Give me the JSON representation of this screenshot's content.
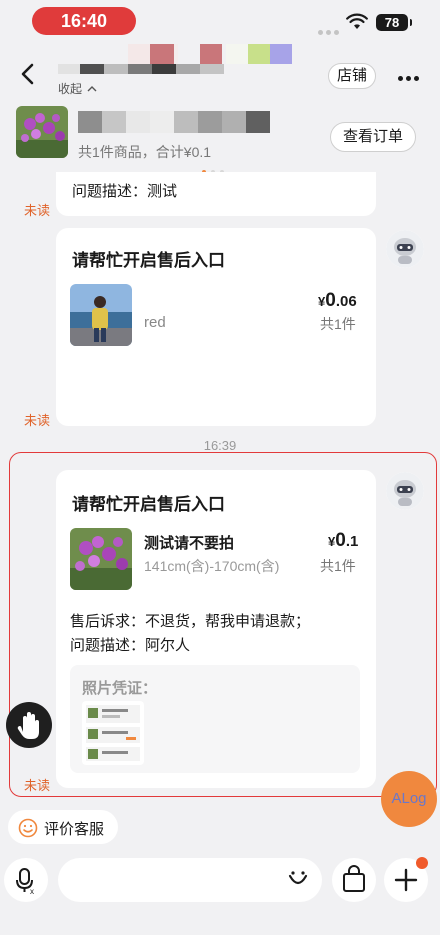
{
  "status_bar": {
    "time": "16:40",
    "battery": "78"
  },
  "header": {
    "collapse_label": "收起",
    "shop_label": "店铺"
  },
  "order_banner": {
    "summary": "共1件商品，合计¥0.1",
    "view_order_label": "查看订单"
  },
  "messages": [
    {
      "issue_text": "问题描述：测试",
      "unread": "未读"
    },
    {
      "title": "请帮忙开启售后入口",
      "product_name": "red",
      "price_symbol": "¥",
      "price_int": "0",
      "price_dec": ".06",
      "qty": "共1件",
      "unread": "未读"
    },
    {
      "title": "请帮忙开启售后入口",
      "product_name": "测试请不要拍",
      "product_spec": "141cm(含)-170cm(含)",
      "price_symbol": "¥",
      "price_int": "0",
      "price_dec": ".1",
      "qty": "共1件",
      "request_text": "售后诉求：不退货，帮我申请退款；",
      "issue_text": "问题描述：阿尔人",
      "photo_label": "照片凭证：",
      "unread": "未读"
    }
  ],
  "timestamp": "16:39",
  "fab": {
    "alog_label": "ALog"
  },
  "quick_action": {
    "review_label": "评价客服"
  },
  "colors": {
    "accent": "#f0883e",
    "unread": "#e0632a",
    "highlight": "#e23a3a"
  }
}
